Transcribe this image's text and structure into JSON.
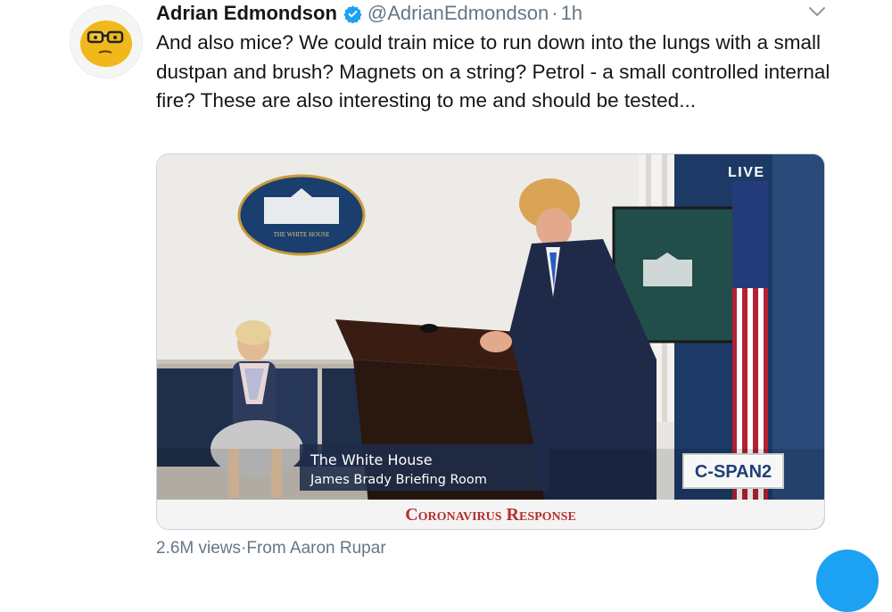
{
  "tweet": {
    "author_name": "Adrian Edmondson",
    "handle": "@AdrianEdmondson",
    "separator": "·",
    "time": "1h",
    "text": "And also mice? We could train mice to run down into the lungs with a small dustpan and brush? Magnets on a string? Petrol - a small controlled internal fire? These are also interesting to me and should be tested..."
  },
  "video": {
    "live_badge": "LIVE",
    "lower_third_line1": "The White House",
    "lower_third_line2": "James Brady Briefing Room",
    "network_logo": "C-SPAN2",
    "banner": "Coronavirus Response",
    "seal_text": "THE WHITE HOUSE"
  },
  "meta": {
    "views": "2.6M views",
    "separator": "·",
    "source": "From Aaron Rupar"
  },
  "icons": {
    "verified": "verified-badge-icon",
    "menu": "chevron-down-icon",
    "compose": "compose-tweet-icon"
  },
  "colors": {
    "accent": "#1da1f2",
    "text": "#14171a",
    "secondary": "#657786",
    "banner_red": "#b5302b"
  }
}
